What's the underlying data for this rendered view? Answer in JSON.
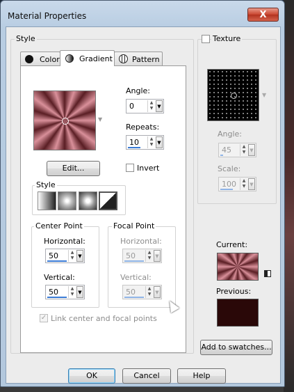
{
  "window": {
    "title": "Material Properties",
    "close_label": "X"
  },
  "style_group": {
    "title": "Style"
  },
  "tabs": [
    {
      "label": "Color",
      "icon": "color-circle-icon"
    },
    {
      "label": "Gradient",
      "icon": "gradient-circle-icon"
    },
    {
      "label": "Pattern",
      "icon": "pattern-globe-icon"
    }
  ],
  "gradient": {
    "edit_label": "Edit...",
    "angle_label": "Angle:",
    "angle_value": "0",
    "repeats_label": "Repeats:",
    "repeats_value": "10",
    "invert_label": "Invert",
    "invert_checked": false,
    "style_title": "Style",
    "styles": [
      "linear",
      "rectangular",
      "sunburst",
      "radial"
    ],
    "center_point": {
      "title": "Center Point",
      "horizontal_label": "Horizontal:",
      "horizontal_value": "50",
      "vertical_label": "Vertical:",
      "vertical_value": "50"
    },
    "focal_point": {
      "title": "Focal Point",
      "horizontal_label": "Horizontal:",
      "horizontal_value": "50",
      "vertical_label": "Vertical:",
      "vertical_value": "50"
    },
    "link_label": "Link center and focal points",
    "link_checked": true
  },
  "texture": {
    "label": "Texture",
    "checked": false,
    "angle_label": "Angle:",
    "angle_value": "45",
    "scale_label": "Scale:",
    "scale_value": "100"
  },
  "preview": {
    "current_label": "Current:",
    "previous_label": "Previous:",
    "previous_color": "#2a0808"
  },
  "buttons": {
    "add_swatches": "Add to swatches...",
    "ok": "OK",
    "cancel": "Cancel",
    "help": "Help"
  },
  "colors": {
    "gradient_dark": "#5a1e24",
    "gradient_light": "#d9909a",
    "accent": "#3a7bd5"
  }
}
